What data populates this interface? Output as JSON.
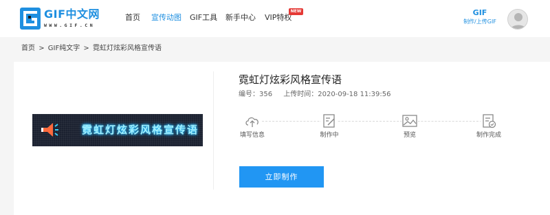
{
  "header": {
    "logo": {
      "title": "GIF中文网",
      "url": "WWW.GIF.CN"
    },
    "nav": [
      {
        "label": "首页",
        "active": false
      },
      {
        "label": "宣传动图",
        "active": true
      },
      {
        "label": "GIF工具",
        "active": false
      },
      {
        "label": "新手中心",
        "active": false
      },
      {
        "label": "VIP特权",
        "active": false
      }
    ],
    "new_badge": "NEW",
    "make_gif": {
      "title": "GIF",
      "subtitle": "制作/上传GIF"
    },
    "accent_color": "#1e8fe0"
  },
  "breadcrumb": {
    "items": [
      "首页",
      "GIF纯文字",
      "霓虹灯炫彩风格宣传语"
    ],
    "separator": ">"
  },
  "preview": {
    "text": "霓虹灯炫彩风格宣传语",
    "icon": "megaphone-icon"
  },
  "info": {
    "title": "霓虹灯炫彩风格宣传语",
    "id_text": "编号：356",
    "time_text": "上传时间：2020-09-18 11:39:56"
  },
  "steps": [
    {
      "label": "填写信息",
      "icon": "cloud-upload-icon"
    },
    {
      "label": "制作中",
      "icon": "edit-document-icon"
    },
    {
      "label": "预览",
      "icon": "image-preview-icon"
    },
    {
      "label": "制作完成",
      "icon": "document-check-icon"
    }
  ],
  "cta": {
    "label": "立即制作",
    "color": "#2196f3"
  }
}
